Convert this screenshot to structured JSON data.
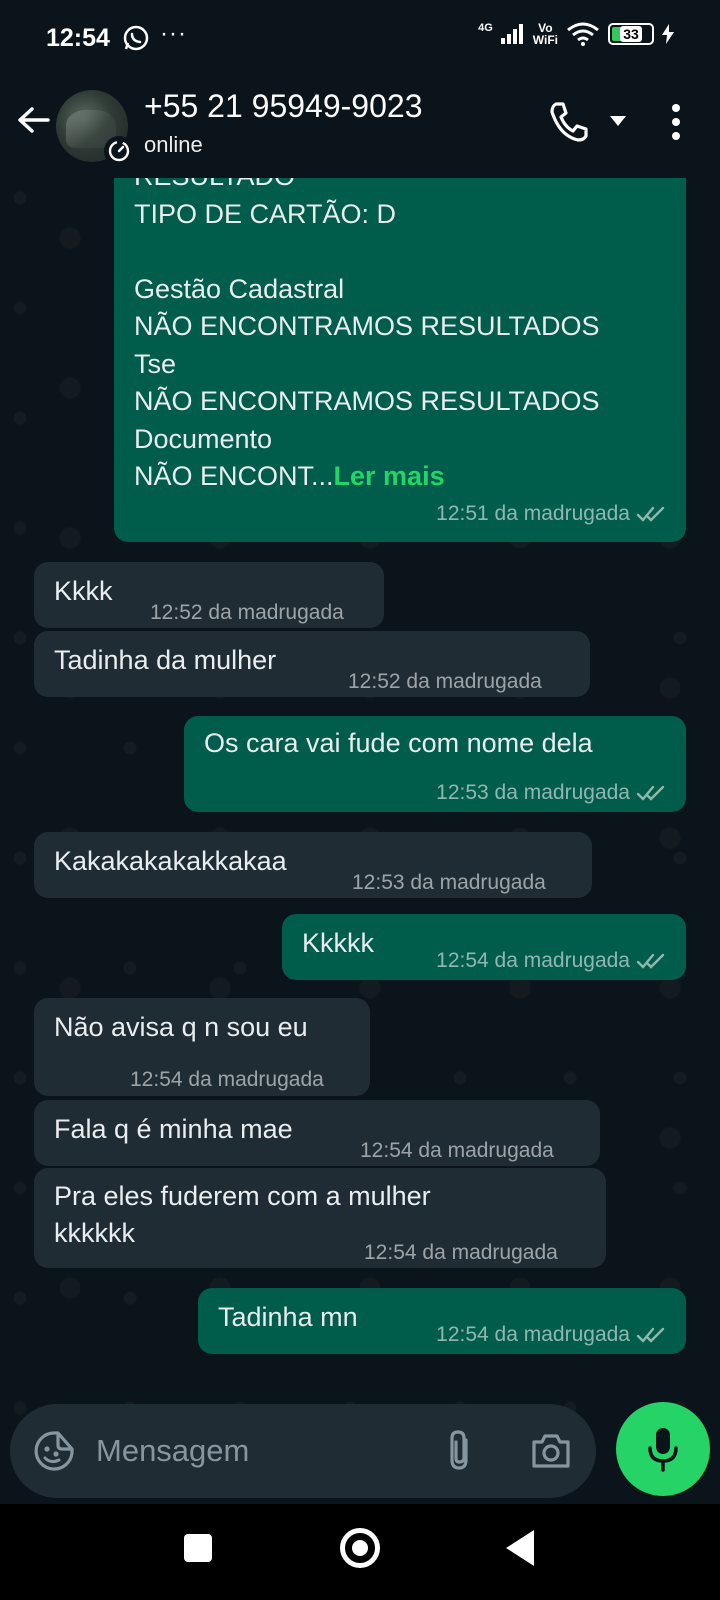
{
  "status_bar": {
    "time": "12:54",
    "overflow": "···",
    "network": "4G",
    "vowifi": "Vo\nWiFi",
    "battery": "33"
  },
  "header": {
    "contact_name": "+55 21 95949-9023",
    "status": "online"
  },
  "messages": [
    {
      "direction": "outgoing",
      "text": "RESULTADO\nTIPO DE CARTÃO: D\n\nGestão Cadastral\nNÃO ENCONTRAMOS RESULTADOS\nTse\nNÃO ENCONTRAMOS RESULTADOS\nDocumento\nNÃO ENCONT...",
      "read_more": "Ler mais",
      "time": "12:51 da madrugada",
      "read": true
    },
    {
      "direction": "incoming",
      "text": "Kkkk",
      "time": "12:52 da madrugada"
    },
    {
      "direction": "incoming",
      "text": "Tadinha da mulher",
      "time": "12:52 da madrugada"
    },
    {
      "direction": "outgoing",
      "text": "Os cara vai fude com nome dela",
      "time": "12:53 da madrugada",
      "read": true
    },
    {
      "direction": "incoming",
      "text": "Kakakakakakkakaa",
      "time": "12:53 da madrugada"
    },
    {
      "direction": "outgoing",
      "text": "Kkkkk",
      "time": "12:54 da madrugada",
      "read": true
    },
    {
      "direction": "incoming",
      "text": "Não avisa q n sou eu",
      "time": "12:54 da madrugada"
    },
    {
      "direction": "incoming",
      "text": "Fala q é minha mae",
      "time": "12:54 da madrugada"
    },
    {
      "direction": "incoming",
      "text": "Pra eles fuderem com a mulher\nkkkkkk",
      "time": "12:54 da madrugada"
    },
    {
      "direction": "outgoing",
      "text": "Tadinha mn",
      "time": "12:54 da madrugada",
      "read": true
    }
  ],
  "composer": {
    "placeholder": "Mensagem"
  },
  "colors": {
    "background": "#0b141a",
    "outgoing_bubble": "#005c4b",
    "incoming_bubble": "#202c33",
    "accent_green": "#25d366",
    "read_ticks": "#8fb8ae"
  },
  "icons": {
    "status_bar": [
      "whatsapp-icon",
      "signal-icon",
      "wifi-icon",
      "battery-icon",
      "charging-icon"
    ],
    "header": [
      "back-arrow-icon",
      "disappearing-timer-icon",
      "phone-icon",
      "caret-down-icon",
      "more-vertical-icon"
    ],
    "composer": [
      "sticker-emoji-icon",
      "paperclip-icon",
      "camera-icon",
      "microphone-icon"
    ],
    "navbar": [
      "recents-icon",
      "home-icon",
      "back-triangle-icon"
    ]
  }
}
